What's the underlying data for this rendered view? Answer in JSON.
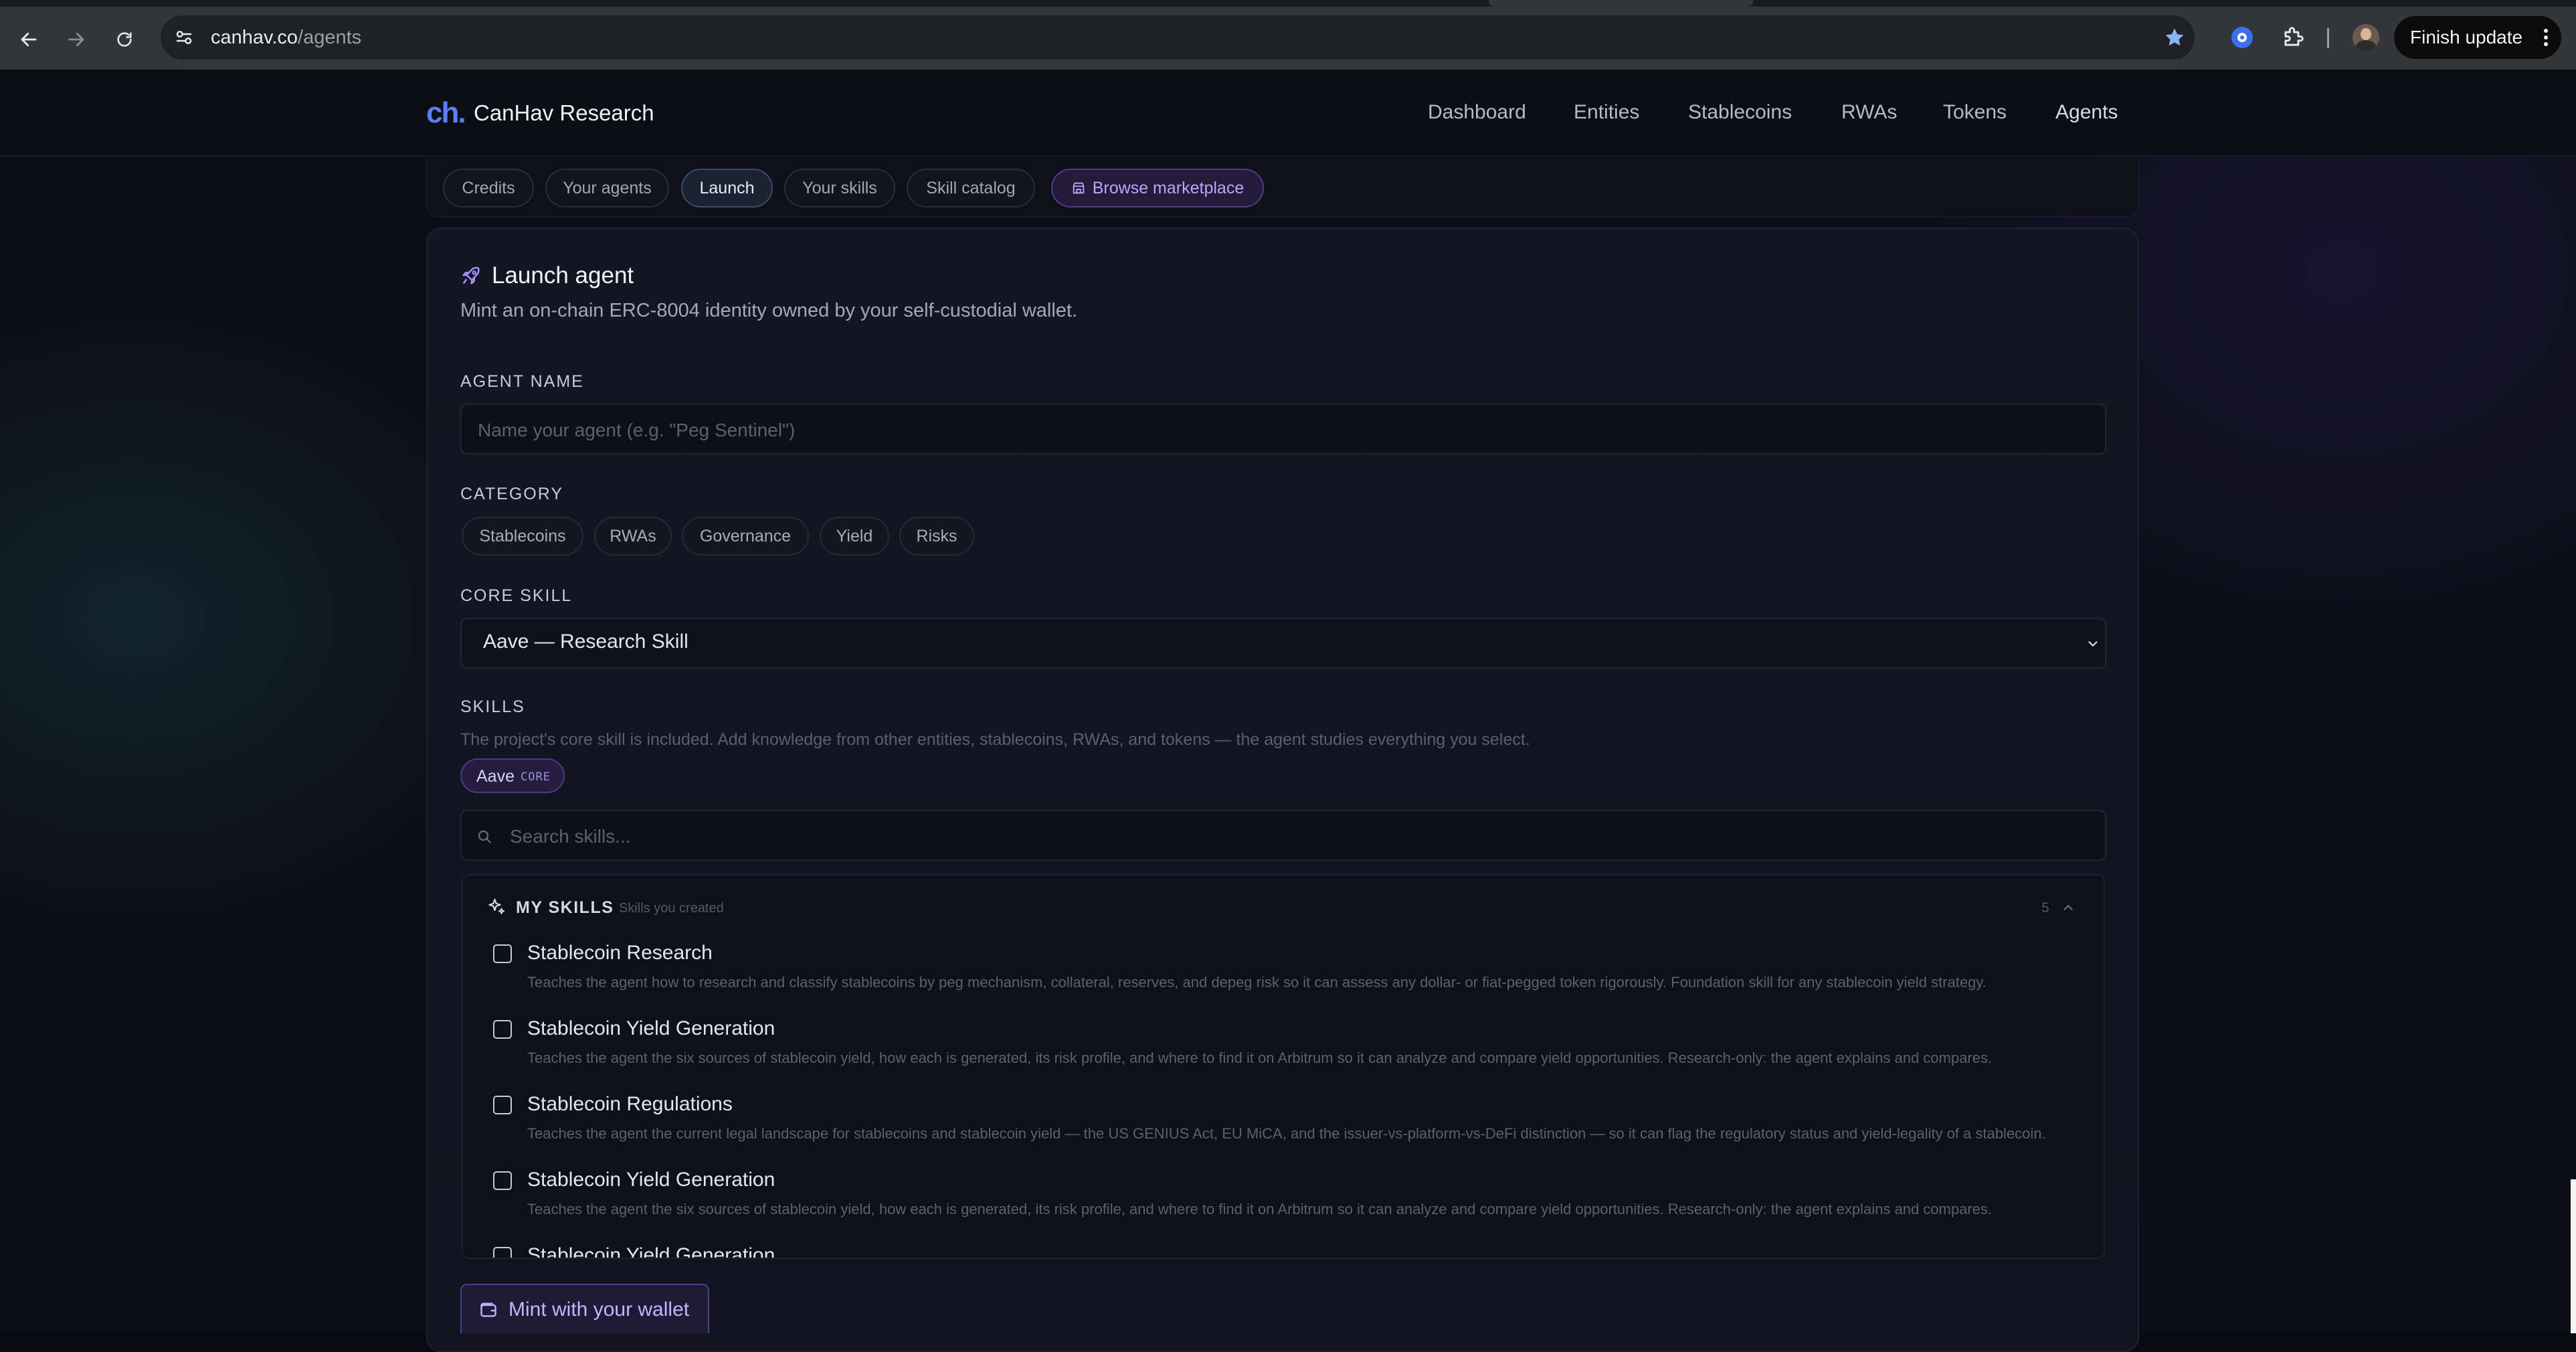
{
  "browser": {
    "url_host": "canhav.co",
    "url_path": "/agents",
    "finish_update_label": "Finish update"
  },
  "header": {
    "logo_text": "ch.",
    "brand": "CanHav Research",
    "nav": [
      "Dashboard",
      "Entities",
      "Stablecoins",
      "RWAs",
      "Tokens",
      "Agents"
    ]
  },
  "subtabs": {
    "items": [
      "Credits",
      "Your agents",
      "Launch",
      "Your skills",
      "Skill catalog"
    ],
    "active": "Launch",
    "marketplace_label": "Browse marketplace"
  },
  "launch": {
    "title": "Launch agent",
    "subtitle": "Mint an on-chain ERC-8004 identity owned by your self-custodial wallet.",
    "agent_name_label": "AGENT NAME",
    "agent_name_placeholder": "Name your agent (e.g. \"Peg Sentinel\")",
    "category_label": "CATEGORY",
    "categories": [
      "Stablecoins",
      "RWAs",
      "Governance",
      "Yield",
      "Risks"
    ],
    "core_skill_label": "CORE SKILL",
    "core_skill_value": "Aave — Research Skill",
    "skills_label": "SKILLS",
    "skills_hint": "The project's core skill is included. Add knowledge from other entities, stablecoins, RWAs, and tokens — the agent studies everything you select.",
    "selected_chip": {
      "name": "Aave",
      "tag": "CORE"
    },
    "search_placeholder": "Search skills...",
    "my_skills": {
      "title": "MY SKILLS",
      "subtitle": "Skills you created",
      "count": "5",
      "items": [
        {
          "name": "Stablecoin Research",
          "desc": "Teaches the agent how to research and classify stablecoins by peg mechanism, collateral, reserves, and depeg risk so it can assess any dollar- or fiat-pegged token rigorously. Foundation skill for any stablecoin yield strategy.",
          "checked": false
        },
        {
          "name": "Stablecoin Yield Generation",
          "desc": "Teaches the agent the six sources of stablecoin yield, how each is generated, its risk profile, and where to find it on Arbitrum so it can analyze and compare yield opportunities. Research-only: the agent explains and compares.",
          "checked": false
        },
        {
          "name": "Stablecoin Regulations",
          "desc": "Teaches the agent the current legal landscape for stablecoins and stablecoin yield — the US GENIUS Act, EU MiCA, and the issuer-vs-platform-vs-DeFi distinction — so it can flag the regulatory status and yield-legality of a stablecoin.",
          "checked": false
        },
        {
          "name": "Stablecoin Yield Generation",
          "desc": "Teaches the agent the six sources of stablecoin yield, how each is generated, its risk profile, and where to find it on Arbitrum so it can analyze and compare yield opportunities. Research-only: the agent explains and compares.",
          "checked": false
        },
        {
          "name": "Stablecoin Yield Generation",
          "desc": "",
          "checked": false
        }
      ]
    },
    "mint_label": "Mint with your wallet"
  },
  "colors": {
    "accent": "#5e7cff",
    "purple_accent": "#b9a7ff",
    "background": "#0c0d16"
  }
}
